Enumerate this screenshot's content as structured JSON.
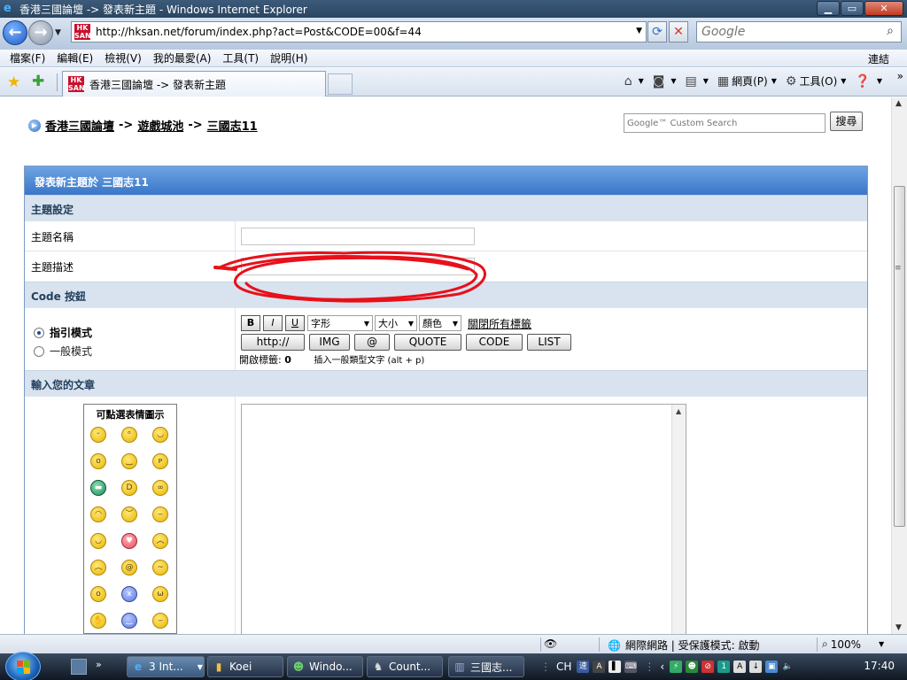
{
  "window": {
    "title": "香港三國論壇 -> 發表新主題 - Windows Internet Explorer"
  },
  "address": {
    "url": "http://hksan.net/forum/index.php?act=Post&CODE=00&f=44",
    "site_icon_text": "HK SAN",
    "search_placeholder": "Google"
  },
  "menu": {
    "items": [
      "檔案(F)",
      "編輯(E)",
      "檢視(V)",
      "我的最愛(A)",
      "工具(T)",
      "說明(H)"
    ],
    "links_label": "連結"
  },
  "tab": {
    "title": "香港三國論壇 -> 發表新主題"
  },
  "commandbar": {
    "page_label": "網頁(P)",
    "tools_label": "工具(O)"
  },
  "breadcrumb": {
    "items": [
      "香港三國論壇",
      "遊戲城池",
      "三國志11"
    ],
    "separator": "->"
  },
  "google_search": {
    "placeholder": "Google™ Custom Search",
    "button_label": "搜尋"
  },
  "form": {
    "header": "發表新主題於 三國志11",
    "topic_settings": {
      "section_title": "主題設定",
      "title_label": "主題名稱",
      "description_label": "主題描述"
    },
    "code_buttons": {
      "section_title": "Code 按鈕",
      "guided_mode": "指引模式",
      "normal_mode": "一般模式",
      "bold": "B",
      "italic": "I",
      "underline": "U",
      "font_select": "字形",
      "size_select": "大小",
      "color_select": "顏色",
      "close_all_tags": "關閉所有標籤",
      "buttons": [
        "http://",
        "IMG",
        "@",
        "QUOTE",
        "CODE",
        "LIST"
      ],
      "open_tags_label": "開啟標籤:",
      "open_tags_count": "0",
      "hint": "插入一般類型文字 (alt + p)"
    },
    "message": {
      "section_title": "輸入您的文章",
      "emoticon_title": "可點選表情圖示"
    }
  },
  "statusbar": {
    "zone": "網際網路 | 受保護模式: 啟動",
    "zoom": "100%"
  },
  "taskbar": {
    "items": [
      "3 Int...",
      "Koei",
      "Windo...",
      "Count...",
      "三國志..."
    ],
    "language": "CH",
    "time": "17:40"
  },
  "colors": {
    "form_header": "#3a76c8",
    "section_bg": "#d8e3ef",
    "scribble": "#e8101a"
  }
}
